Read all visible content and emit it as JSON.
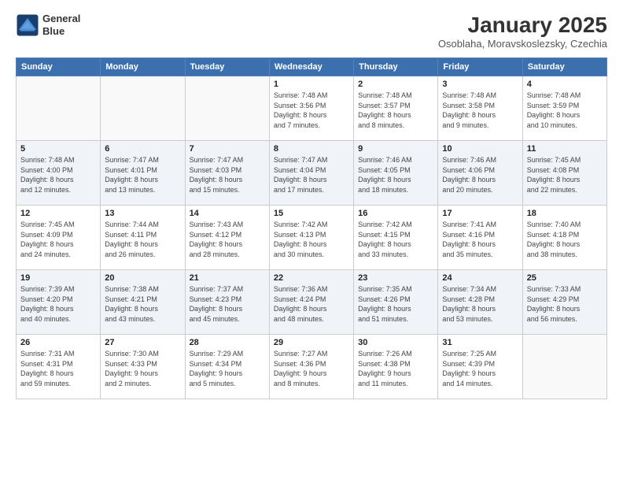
{
  "logo": {
    "line1": "General",
    "line2": "Blue"
  },
  "title": "January 2025",
  "location": "Osoblaha, Moravskoslezsky, Czechia",
  "weekdays": [
    "Sunday",
    "Monday",
    "Tuesday",
    "Wednesday",
    "Thursday",
    "Friday",
    "Saturday"
  ],
  "weeks": [
    [
      {
        "day": "",
        "info": ""
      },
      {
        "day": "",
        "info": ""
      },
      {
        "day": "",
        "info": ""
      },
      {
        "day": "1",
        "info": "Sunrise: 7:48 AM\nSunset: 3:56 PM\nDaylight: 8 hours\nand 7 minutes."
      },
      {
        "day": "2",
        "info": "Sunrise: 7:48 AM\nSunset: 3:57 PM\nDaylight: 8 hours\nand 8 minutes."
      },
      {
        "day": "3",
        "info": "Sunrise: 7:48 AM\nSunset: 3:58 PM\nDaylight: 8 hours\nand 9 minutes."
      },
      {
        "day": "4",
        "info": "Sunrise: 7:48 AM\nSunset: 3:59 PM\nDaylight: 8 hours\nand 10 minutes."
      }
    ],
    [
      {
        "day": "5",
        "info": "Sunrise: 7:48 AM\nSunset: 4:00 PM\nDaylight: 8 hours\nand 12 minutes."
      },
      {
        "day": "6",
        "info": "Sunrise: 7:47 AM\nSunset: 4:01 PM\nDaylight: 8 hours\nand 13 minutes."
      },
      {
        "day": "7",
        "info": "Sunrise: 7:47 AM\nSunset: 4:03 PM\nDaylight: 8 hours\nand 15 minutes."
      },
      {
        "day": "8",
        "info": "Sunrise: 7:47 AM\nSunset: 4:04 PM\nDaylight: 8 hours\nand 17 minutes."
      },
      {
        "day": "9",
        "info": "Sunrise: 7:46 AM\nSunset: 4:05 PM\nDaylight: 8 hours\nand 18 minutes."
      },
      {
        "day": "10",
        "info": "Sunrise: 7:46 AM\nSunset: 4:06 PM\nDaylight: 8 hours\nand 20 minutes."
      },
      {
        "day": "11",
        "info": "Sunrise: 7:45 AM\nSunset: 4:08 PM\nDaylight: 8 hours\nand 22 minutes."
      }
    ],
    [
      {
        "day": "12",
        "info": "Sunrise: 7:45 AM\nSunset: 4:09 PM\nDaylight: 8 hours\nand 24 minutes."
      },
      {
        "day": "13",
        "info": "Sunrise: 7:44 AM\nSunset: 4:11 PM\nDaylight: 8 hours\nand 26 minutes."
      },
      {
        "day": "14",
        "info": "Sunrise: 7:43 AM\nSunset: 4:12 PM\nDaylight: 8 hours\nand 28 minutes."
      },
      {
        "day": "15",
        "info": "Sunrise: 7:42 AM\nSunset: 4:13 PM\nDaylight: 8 hours\nand 30 minutes."
      },
      {
        "day": "16",
        "info": "Sunrise: 7:42 AM\nSunset: 4:15 PM\nDaylight: 8 hours\nand 33 minutes."
      },
      {
        "day": "17",
        "info": "Sunrise: 7:41 AM\nSunset: 4:16 PM\nDaylight: 8 hours\nand 35 minutes."
      },
      {
        "day": "18",
        "info": "Sunrise: 7:40 AM\nSunset: 4:18 PM\nDaylight: 8 hours\nand 38 minutes."
      }
    ],
    [
      {
        "day": "19",
        "info": "Sunrise: 7:39 AM\nSunset: 4:20 PM\nDaylight: 8 hours\nand 40 minutes."
      },
      {
        "day": "20",
        "info": "Sunrise: 7:38 AM\nSunset: 4:21 PM\nDaylight: 8 hours\nand 43 minutes."
      },
      {
        "day": "21",
        "info": "Sunrise: 7:37 AM\nSunset: 4:23 PM\nDaylight: 8 hours\nand 45 minutes."
      },
      {
        "day": "22",
        "info": "Sunrise: 7:36 AM\nSunset: 4:24 PM\nDaylight: 8 hours\nand 48 minutes."
      },
      {
        "day": "23",
        "info": "Sunrise: 7:35 AM\nSunset: 4:26 PM\nDaylight: 8 hours\nand 51 minutes."
      },
      {
        "day": "24",
        "info": "Sunrise: 7:34 AM\nSunset: 4:28 PM\nDaylight: 8 hours\nand 53 minutes."
      },
      {
        "day": "25",
        "info": "Sunrise: 7:33 AM\nSunset: 4:29 PM\nDaylight: 8 hours\nand 56 minutes."
      }
    ],
    [
      {
        "day": "26",
        "info": "Sunrise: 7:31 AM\nSunset: 4:31 PM\nDaylight: 8 hours\nand 59 minutes."
      },
      {
        "day": "27",
        "info": "Sunrise: 7:30 AM\nSunset: 4:33 PM\nDaylight: 9 hours\nand 2 minutes."
      },
      {
        "day": "28",
        "info": "Sunrise: 7:29 AM\nSunset: 4:34 PM\nDaylight: 9 hours\nand 5 minutes."
      },
      {
        "day": "29",
        "info": "Sunrise: 7:27 AM\nSunset: 4:36 PM\nDaylight: 9 hours\nand 8 minutes."
      },
      {
        "day": "30",
        "info": "Sunrise: 7:26 AM\nSunset: 4:38 PM\nDaylight: 9 hours\nand 11 minutes."
      },
      {
        "day": "31",
        "info": "Sunrise: 7:25 AM\nSunset: 4:39 PM\nDaylight: 9 hours\nand 14 minutes."
      },
      {
        "day": "",
        "info": ""
      }
    ]
  ]
}
